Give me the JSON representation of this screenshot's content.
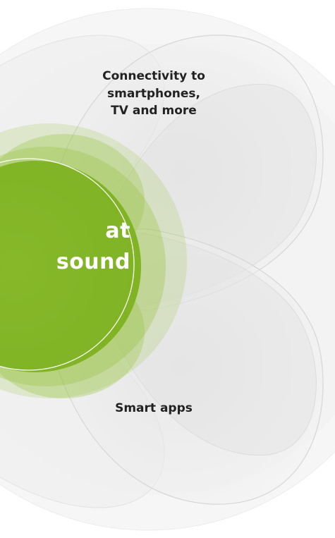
{
  "diagram": {
    "petals": [
      {
        "label": "Connectivity to\nsmartphones,\nTV and more"
      },
      {
        "label": "Smart apps"
      }
    ],
    "center": {
      "label": "at\nsound"
    }
  },
  "colors": {
    "background": "#ffffff",
    "petal_fill": "#e9e9e9",
    "petal_stroke": "#d9d9d9",
    "center_green": "#8dbb2c",
    "center_green_dark": "#7fb324",
    "center_text": "#ffffff",
    "label_text": "#222222"
  }
}
